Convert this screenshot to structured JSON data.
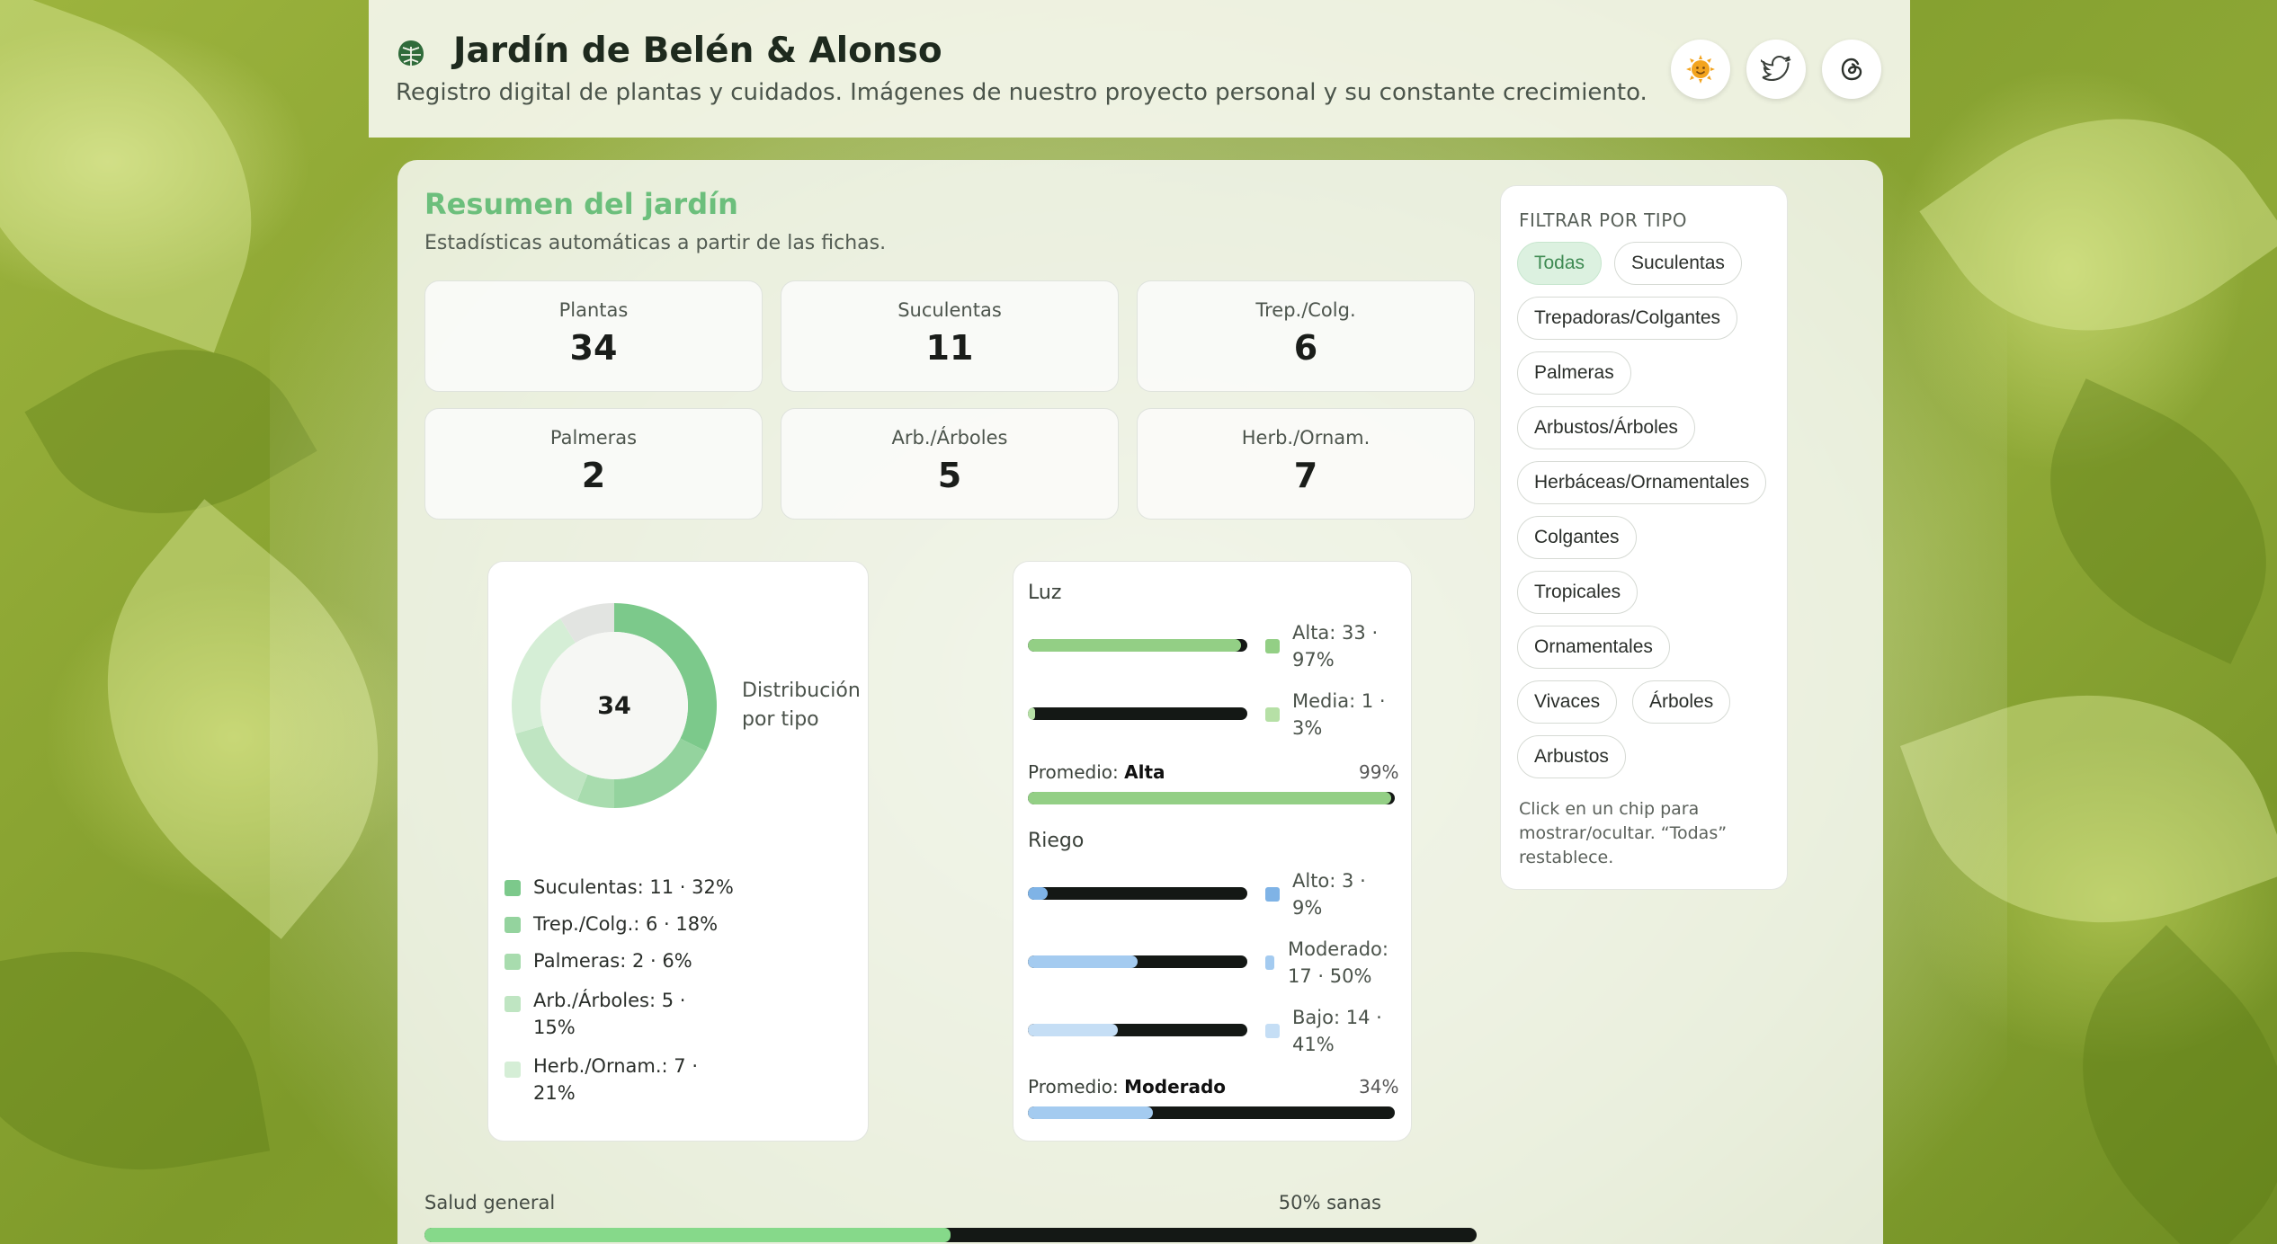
{
  "header": {
    "title": "Jardín de Belén & Alonso",
    "subtitle": "Registro digital de plantas y cuidados. Imágenes de nuestro proyecto personal y su constante crecimiento.",
    "buttons": [
      "sun-face-icon",
      "twitter-bird-icon",
      "threads-icon"
    ]
  },
  "summary": {
    "title": "Resumen del jardín",
    "description": "Estadísticas automáticas a partir de las fichas.",
    "stats": [
      {
        "label": "Plantas",
        "value": "34"
      },
      {
        "label": "Suculentas",
        "value": "11"
      },
      {
        "label": "Trep./Colg.",
        "value": "6"
      },
      {
        "label": "Palmeras",
        "value": "2"
      },
      {
        "label": "Arb./Árboles",
        "value": "5"
      },
      {
        "label": "Herb./Ornam.",
        "value": "7"
      }
    ]
  },
  "donut": {
    "center": "34",
    "caption": "Distribución por tipo",
    "legend": [
      {
        "label": "Suculentas: 11 · 32%",
        "color": "#7cc98b",
        "fraction": 0.3235
      },
      {
        "label": "Trep./Colg.: 6 · 18%",
        "color": "#94d39e",
        "fraction": 0.1765
      },
      {
        "label": "Palmeras: 2 · 6%",
        "color": "#a8dcae",
        "fraction": 0.0588
      },
      {
        "label": "Arb./Árboles: 5 · 15%",
        "color": "#bfe5c2",
        "fraction": 0.1471
      },
      {
        "label": "Herb./Ornam.: 7 · 21%",
        "color": "#d5eed6",
        "fraction": 0.2059
      }
    ],
    "remainder_color": "#e2e4e1"
  },
  "light": {
    "title": "Luz",
    "rows": [
      {
        "label": "Alta: 33 · 97%",
        "fraction": 0.97,
        "color": "#93cf85"
      },
      {
        "label": "Media: 1 · 3%",
        "fraction": 0.03,
        "color": "#b6e0a6"
      }
    ],
    "average_label": "Promedio:",
    "average_value": "Alta",
    "average_pct": "99%",
    "average_fraction": 0.99,
    "average_color": "#93cf85"
  },
  "water": {
    "title": "Riego",
    "rows": [
      {
        "label": "Alto: 3 · 9%",
        "fraction": 0.09,
        "color": "#7fb3e6"
      },
      {
        "label": "Moderado: 17 · 50%",
        "fraction": 0.5,
        "color": "#a4cbf0"
      },
      {
        "label": "Bajo: 14 · 41%",
        "fraction": 0.41,
        "color": "#c5def5"
      }
    ],
    "average_label": "Promedio:",
    "average_value": "Moderado",
    "average_pct": "34%",
    "average_fraction": 0.34,
    "average_color": "#a4cbf0"
  },
  "health": {
    "label": "Salud general",
    "value": "50% sanas",
    "fraction": 0.5,
    "color": "#86d98a"
  },
  "filter": {
    "title": "FILTRAR POR TIPO",
    "chips": [
      "Todas",
      "Suculentas",
      "Trepadoras/Colgantes",
      "Palmeras",
      "Arbustos/Árboles",
      "Herbáceas/Ornamentales",
      "Colgantes",
      "Tropicales",
      "Ornamentales",
      "Vivaces",
      "Árboles",
      "Arbustos"
    ],
    "active": "Todas",
    "hint": "Click en un chip para mostrar/ocultar. “Todas” restablece."
  }
}
